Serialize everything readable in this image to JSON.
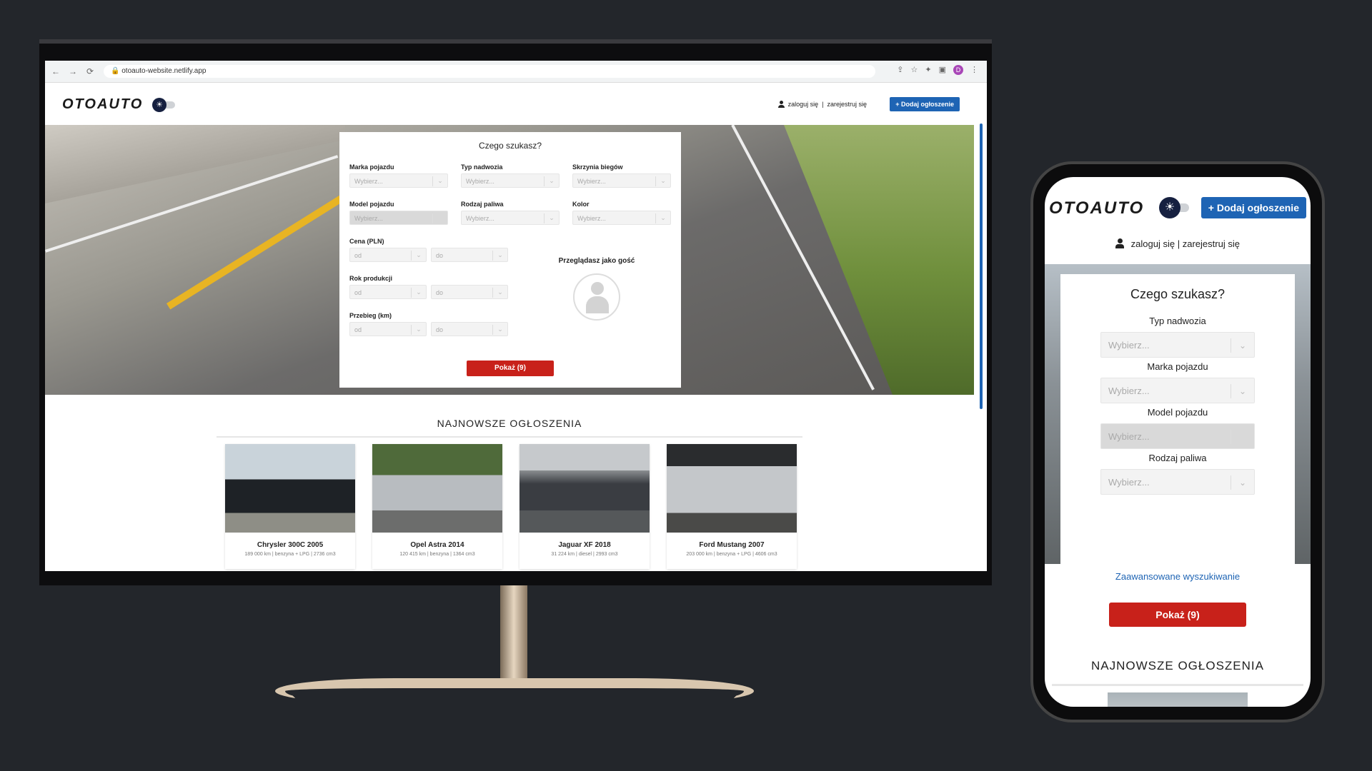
{
  "desktop": {
    "browser": {
      "url": "otoauto-website.netlify.app",
      "profile_initial": "D"
    },
    "header": {
      "logo": "OTOAUTO",
      "login": "zaloguj się",
      "separator": "|",
      "register": "zarejestruj się",
      "add_listing": "+ Dodaj ogłoszenie"
    },
    "search": {
      "title": "Czego szukasz?",
      "fields": {
        "brand": {
          "label": "Marka pojazdu",
          "placeholder": "Wybierz..."
        },
        "body_type": {
          "label": "Typ nadwozia",
          "placeholder": "Wybierz..."
        },
        "gearbox": {
          "label": "Skrzynia biegów",
          "placeholder": "Wybierz..."
        },
        "model": {
          "label": "Model pojazdu",
          "placeholder": "Wybierz..."
        },
        "fuel": {
          "label": "Rodzaj paliwa",
          "placeholder": "Wybierz..."
        },
        "color": {
          "label": "Kolor",
          "placeholder": "Wybierz..."
        },
        "price": {
          "label": "Cena (PLN)",
          "from": "od",
          "to": "do"
        },
        "year": {
          "label": "Rok produkcji",
          "from": "od",
          "to": "do"
        },
        "mileage": {
          "label": "Przebieg (km)",
          "from": "od",
          "to": "do"
        }
      },
      "guest": "Przeglądasz jako gość",
      "show_button": "Pokaż (9)"
    },
    "newest": {
      "title": "NAJNOWSZE OGŁOSZENIA",
      "cards": [
        {
          "title": "Chrysler 300C 2005",
          "specs": "189 000 km | benzyna + LPG | 2736 cm3",
          "color": "#1e2226"
        },
        {
          "title": "Opel Astra 2014",
          "specs": "120 415 km | benzyna | 1364 cm3",
          "color": "#b8bcc0"
        },
        {
          "title": "Jaguar XF 2018",
          "specs": "31 224 km | diesel | 2993 cm3",
          "color": "#3a3d42"
        },
        {
          "title": "Ford Mustang 2007",
          "specs": "203 000 km | benzyna + LPG | 4606 cm3",
          "color": "#c4c7ca"
        }
      ]
    }
  },
  "mobile": {
    "logo": "OTOAUTO",
    "add_listing": "+ Dodaj ogłoszenie",
    "login": "zaloguj się",
    "separator": "|",
    "register": "zarejestruj się",
    "search_title": "Czego szukasz?",
    "fields": [
      {
        "label": "Typ nadwozia",
        "placeholder": "Wybierz..."
      },
      {
        "label": "Marka pojazdu",
        "placeholder": "Wybierz..."
      },
      {
        "label": "Model pojazdu",
        "placeholder": "Wybierz..."
      },
      {
        "label": "Rodzaj paliwa",
        "placeholder": "Wybierz..."
      }
    ],
    "advanced": "Zaawansowane wyszukiwanie",
    "show_button": "Pokaż (9)",
    "newest_title": "NAJNOWSZE OGŁOSZENIA"
  },
  "colors": {
    "accent_blue": "#1e64b4",
    "action_red": "#c8211a",
    "toggle_navy": "#162040"
  }
}
